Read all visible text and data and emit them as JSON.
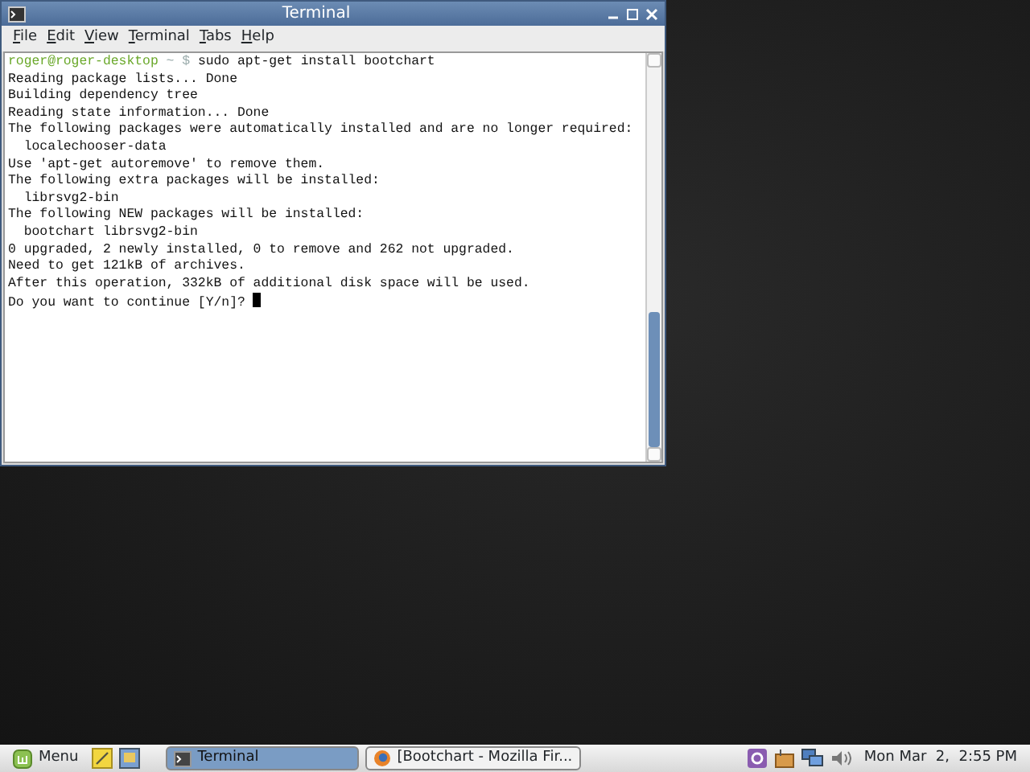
{
  "window": {
    "title": "Terminal",
    "menu": [
      "File",
      "Edit",
      "View",
      "Terminal",
      "Tabs",
      "Help"
    ],
    "lines": [
      {
        "kind": "prompt",
        "user_host": "roger@roger-desktop",
        "path": "~",
        "symbol": "$",
        "command": "sudo apt-get install bootchart"
      },
      {
        "kind": "output",
        "text": "Reading package lists... Done"
      },
      {
        "kind": "output",
        "text": "Building dependency tree"
      },
      {
        "kind": "output",
        "text": "Reading state information... Done"
      },
      {
        "kind": "output",
        "text": "The following packages were automatically installed and are no longer required:"
      },
      {
        "kind": "output",
        "text": "  localechooser-data"
      },
      {
        "kind": "output",
        "text": "Use 'apt-get autoremove' to remove them."
      },
      {
        "kind": "output",
        "text": "The following extra packages will be installed:"
      },
      {
        "kind": "output",
        "text": "  librsvg2-bin"
      },
      {
        "kind": "output",
        "text": "The following NEW packages will be installed:"
      },
      {
        "kind": "output",
        "text": "  bootchart librsvg2-bin"
      },
      {
        "kind": "output",
        "text": "0 upgraded, 2 newly installed, 0 to remove and 262 not upgraded."
      },
      {
        "kind": "output",
        "text": "Need to get 121kB of archives."
      },
      {
        "kind": "output",
        "text": "After this operation, 332kB of additional disk space will be used."
      },
      {
        "kind": "input",
        "text": "Do you want to continue [Y/n]?"
      }
    ]
  },
  "taskbar": {
    "menu_label": "Menu",
    "tasks": [
      {
        "kind": "terminal",
        "label": "Terminal",
        "selected": true
      },
      {
        "kind": "browser",
        "label": "[Bootchart - Mozilla Fir...",
        "selected": false
      }
    ],
    "clock": "Mon Mar  2,  2:55 PM"
  }
}
